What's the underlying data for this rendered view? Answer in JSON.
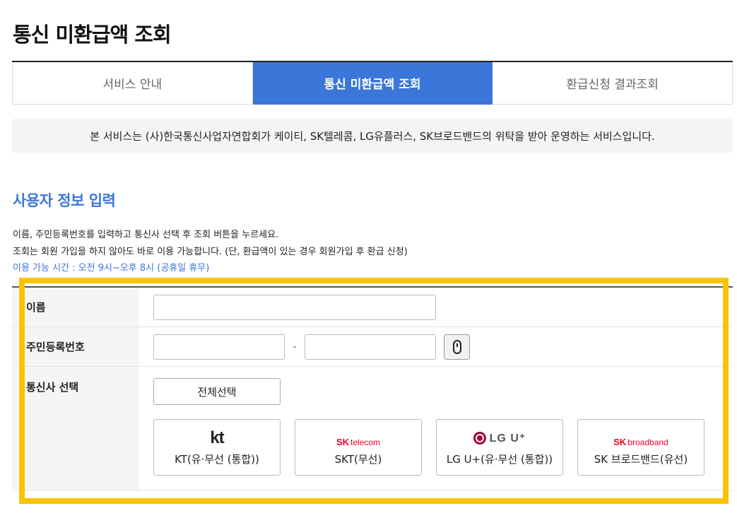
{
  "page": {
    "title": "통신 미환급액 조회"
  },
  "tabs": [
    {
      "label": "서비스 안내",
      "active": false
    },
    {
      "label": "통신 미환급액 조회",
      "active": true
    },
    {
      "label": "환급신청 결과조회",
      "active": false
    }
  ],
  "notice": "본 서비스는 (사)한국통신사업자연합회가 케이티, SK텔레콤, LG유플러스, SK브로드밴드의 위탁을 받아 운영하는 서비스입니다.",
  "section": {
    "title": "사용자 정보 입력",
    "desc1": "이름, 주민등록번호를 입력하고 통신사 선택 후 조회 버튼을 누르세요.",
    "desc2": "조회는 회원 가입을 하지 않아도 바로 이용 가능합니다. (단, 환급액이 있는 경우 회원가입 후 환급 신청)",
    "hours": "이용 가능 시간 : 오전 9시~오후 8시 (공휴일 휴무)"
  },
  "form": {
    "name_label": "이름",
    "name_value": "",
    "rrn_label": "주민등록번호",
    "rrn_first_value": "",
    "rrn_second_value": "",
    "rrn_separator": "-",
    "carrier_label": "통신사 선택",
    "select_all_label": "전체선택"
  },
  "carriers": [
    {
      "logo_text": "kt",
      "logo_sub": "",
      "name": "KT(유·무선 (통합))",
      "icon": "kt-logo-icon"
    },
    {
      "logo_text": "SK",
      "logo_sub": "telecom",
      "name": "SKT(무선)",
      "icon": "sk-telecom-logo-icon"
    },
    {
      "logo_text": "LG U⁺",
      "logo_sub": "",
      "name": "LG U+(유·무선 (통합))",
      "icon": "lg-uplus-logo-icon"
    },
    {
      "logo_text": "SK",
      "logo_sub": "broadband",
      "name": "SK 브로드밴드(유선)",
      "icon": "sk-broadband-logo-icon"
    }
  ],
  "colors": {
    "accent": "#3b76d9",
    "highlight": "#f8c400",
    "sk_red": "#ea0029",
    "lg_red": "#a50034"
  }
}
